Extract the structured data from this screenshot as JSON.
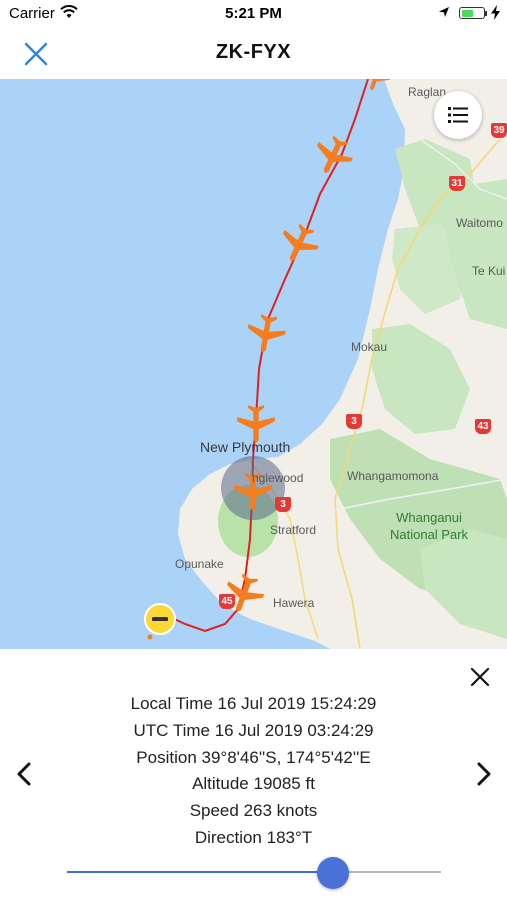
{
  "status": {
    "carrier": "Carrier",
    "time": "5:21 PM"
  },
  "nav": {
    "title": "ZK-FYX",
    "close_icon": "close-icon"
  },
  "map": {
    "labels": {
      "raglan": "Raglan",
      "waitomo": "Waitomo",
      "te_kuiti": "Te Kui",
      "mokau": "Mokau",
      "new_plymouth": "New Plymouth",
      "inglewood": "nglewood",
      "whangamomona": "Whangamomona",
      "whanganui_np_line1": "Whanganui",
      "whanganui_np_line2": "National Park",
      "stratford": "Stratford",
      "opunake": "Opunake",
      "hawera": "Hawera"
    },
    "shields": {
      "r39": "39",
      "r31": "31",
      "r3a": "3",
      "r43": "43",
      "r3b": "3",
      "r45": "45"
    },
    "colors": {
      "sea": "#aad3f7",
      "land": "#f2efe9",
      "forest": "#c8e6c0",
      "track": "#e0201f",
      "plane": "#f57c1f"
    }
  },
  "flight": {
    "local_time": "Local Time 16 Jul 2019 15:24:29",
    "utc_time": "UTC Time 16 Jul 2019 03:24:29",
    "position": "Position 39°8'46''S, 174°5'42''E",
    "altitude": "Altitude 19085 ft",
    "speed": "Speed 263 knots",
    "direction": "Direction 183°T"
  },
  "playback": {
    "progress": 0.71
  }
}
